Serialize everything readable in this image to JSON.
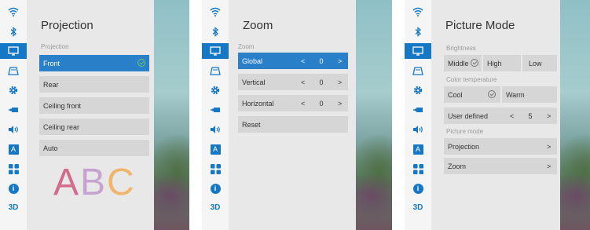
{
  "screens": [
    {
      "title": "Projection",
      "section": "Projection",
      "items": [
        {
          "label": "Front",
          "selected": true
        },
        {
          "label": "Rear"
        },
        {
          "label": "Ceiling front"
        },
        {
          "label": "Ceiling rear"
        },
        {
          "label": "Auto"
        }
      ],
      "sample_letters": [
        "A",
        "B",
        "C"
      ]
    },
    {
      "title": "Zoom",
      "section": "Zoom",
      "items": [
        {
          "label": "Global",
          "value": "0",
          "selected": true
        },
        {
          "label": "Vertical",
          "value": "0"
        },
        {
          "label": "Horizontal",
          "value": "0"
        },
        {
          "label": "Reset"
        }
      ]
    },
    {
      "title": "Picture Mode",
      "brightness_section": "Brightness",
      "brightness_options": [
        "Middle",
        "High",
        "Low"
      ],
      "color_temp_section": "Color temperature",
      "color_temp_options": [
        "Cool",
        "Warm"
      ],
      "user_defined": {
        "label": "User defined",
        "value": "5"
      },
      "picture_mode_section": "Picture mode",
      "picture_mode_items": [
        "Projection",
        "Zoom"
      ]
    }
  ],
  "icon_bar": {
    "icons": [
      "wifi-icon",
      "bluetooth-icon",
      "projection-screen-icon",
      "keystone-icon",
      "settings-gear-icon",
      "input-source-icon",
      "volume-icon",
      "language-icon",
      "apps-icon",
      "info-icon",
      "3d-icon"
    ],
    "language_glyph": "A",
    "info_glyph": "i",
    "label_3d": "3D",
    "selected_icon": "projection-screen-icon"
  },
  "colors": {
    "accent": "#1677c4",
    "selected_row": "#2a7fc9",
    "panel": "#e8e8e8",
    "row": "#d6d6d6",
    "check": "#6cc26c"
  }
}
